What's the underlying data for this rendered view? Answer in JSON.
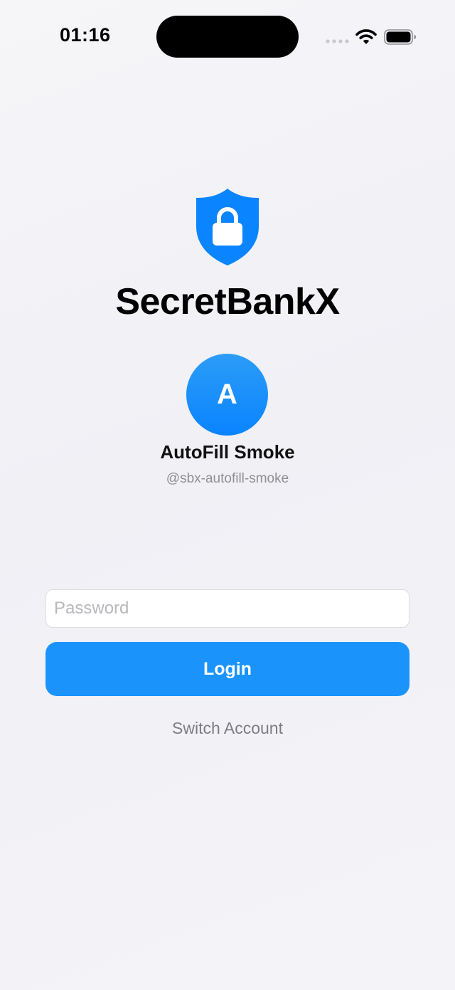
{
  "status_bar": {
    "time": "01:16",
    "icons": [
      "cellular-dots-icon",
      "wifi-icon",
      "battery-icon"
    ]
  },
  "app": {
    "title": "SecretBankX",
    "logo_icon": "shield-lock-icon"
  },
  "account": {
    "avatar_initial": "A",
    "display_name": "AutoFill Smoke",
    "username": "@sbx-autofill-smoke"
  },
  "login_form": {
    "password_placeholder": "Password",
    "password_value": "",
    "login_label": "Login",
    "switch_account_label": "Switch Account"
  },
  "colors": {
    "accent": "#1a94fb",
    "avatar": "#0a84ff",
    "background": "#f2f2f7",
    "secondary_text": "#8e8e93"
  }
}
